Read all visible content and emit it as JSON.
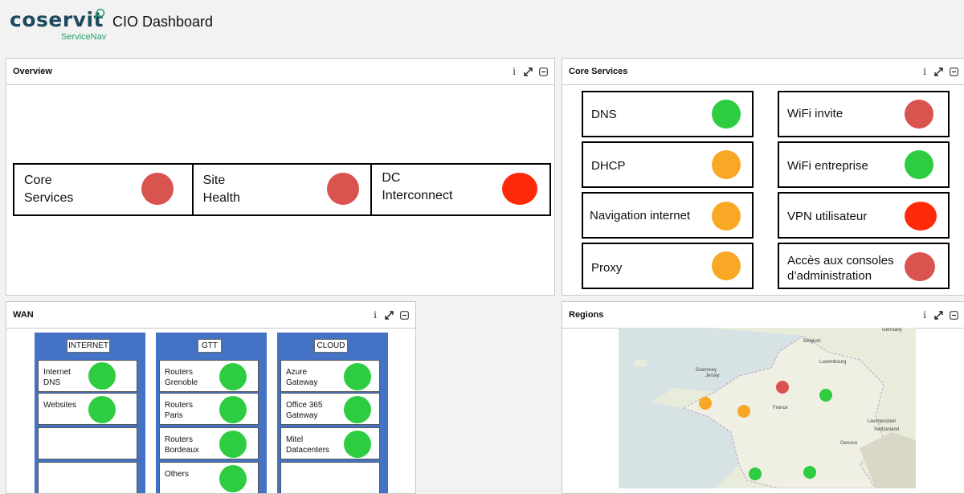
{
  "header": {
    "logo_word": "coservit",
    "logo_sub": "ServiceNav",
    "title": "CIO Dashboard"
  },
  "panels": {
    "overview": {
      "title": "Overview",
      "items": [
        {
          "label": "Core\nServices",
          "status": "#d9534f"
        },
        {
          "label": "Site\nHealth",
          "status": "#d9534f"
        },
        {
          "label": "DC\nInterconnect",
          "status": "#ff2a0a"
        }
      ]
    },
    "core_services": {
      "title": "Core Services",
      "left": [
        {
          "label": "DNS",
          "status": "#2ecc40"
        },
        {
          "label": "DHCP",
          "status": "#f9a825"
        },
        {
          "label": "Navigation internet",
          "status": "#f9a825"
        },
        {
          "label": "Proxy",
          "status": "#f9a825"
        }
      ],
      "right": [
        {
          "label": "WiFi invite",
          "status": "#d9534f"
        },
        {
          "label": "WiFi entreprise",
          "status": "#2ecc40"
        },
        {
          "label": "VPN utilisateur",
          "status": "#ff2a0a"
        },
        {
          "label": "Accès aux consoles\nd’administration",
          "status": "#d9534f"
        }
      ]
    },
    "wan": {
      "title": "WAN",
      "columns": [
        {
          "heading": "INTERNET",
          "items": [
            {
              "label": "Internet\nDNS",
              "status": "#2ecc40"
            },
            {
              "label": "Websites",
              "status": "#2ecc40"
            },
            {
              "label": "",
              "status": ""
            },
            {
              "label": "",
              "status": ""
            }
          ]
        },
        {
          "heading": "GTT",
          "items": [
            {
              "label": "Routers\nGrenoble",
              "status": "#2ecc40"
            },
            {
              "label": "Routers\nParis",
              "status": "#2ecc40"
            },
            {
              "label": "Routers\nBordeaux",
              "status": "#2ecc40"
            },
            {
              "label": "Others",
              "status": "#2ecc40"
            }
          ]
        },
        {
          "heading": "CLOUD",
          "items": [
            {
              "label": "Azure\nGateway",
              "status": "#2ecc40"
            },
            {
              "label": "Office 365\nGateway",
              "status": "#2ecc40"
            },
            {
              "label": "Mitel\nDatacenters",
              "status": "#2ecc40"
            },
            {
              "label": "",
              "status": ""
            }
          ]
        }
      ]
    },
    "regions": {
      "title": "Regions",
      "map_labels": [
        "Germany",
        "Belgium",
        "Luxembourg",
        "Guernsey",
        "Jersey",
        "France",
        "Liechtenstein",
        "Switzerland",
        "Genova"
      ],
      "markers": [
        {
          "status": "#f9a825"
        },
        {
          "status": "#f9a825"
        },
        {
          "status": "#d9534f"
        },
        {
          "status": "#2ecc40"
        },
        {
          "status": "#2ecc40"
        },
        {
          "status": "#2ecc40"
        }
      ]
    }
  }
}
